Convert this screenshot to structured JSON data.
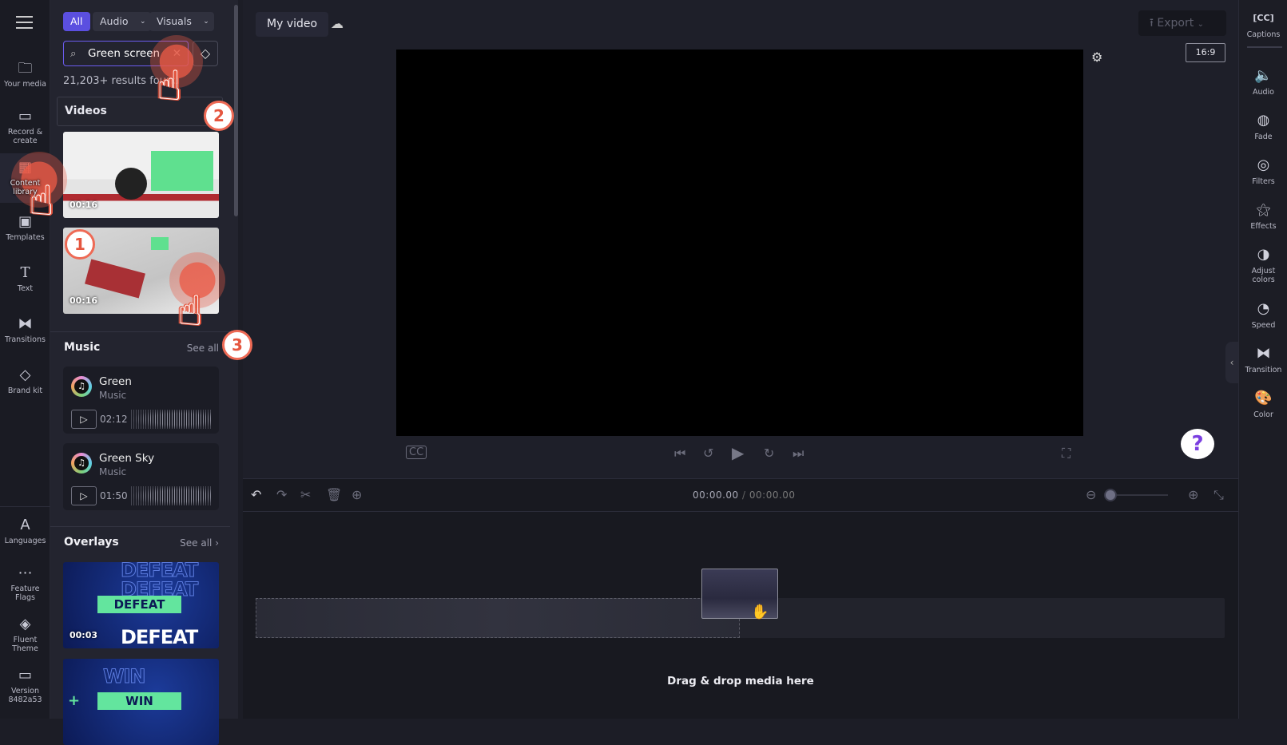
{
  "left_nav": {
    "items": [
      {
        "label": "Your media",
        "icon": "folder-icon"
      },
      {
        "label": "Record & create",
        "icon": "camera-icon"
      },
      {
        "label": "Content library",
        "icon": "content-library-icon",
        "active": true
      },
      {
        "label": "Templates",
        "icon": "templates-icon"
      },
      {
        "label": "Text",
        "icon": "text-icon"
      },
      {
        "label": "Transitions",
        "icon": "transitions-icon"
      },
      {
        "label": "Brand kit",
        "icon": "brand-kit-icon"
      },
      {
        "label": "Languages",
        "icon": "languages-icon"
      },
      {
        "label": "Feature Flags",
        "icon": "more-icon"
      },
      {
        "label": "Fluent Theme",
        "icon": "paint-bucket-icon"
      },
      {
        "label": "Version 8482a53",
        "icon": "archive-icon"
      }
    ]
  },
  "panel": {
    "filters": {
      "all": "All",
      "audio": "Audio",
      "visuals": "Visuals"
    },
    "search": {
      "value": "Green screen"
    },
    "results": "21,203+ results found",
    "videos": {
      "title": "Videos",
      "items": [
        {
          "duration": "00:16"
        },
        {
          "duration": "00:16"
        }
      ]
    },
    "music": {
      "title": "Music",
      "see_all": "See all",
      "items": [
        {
          "name": "Green",
          "type": "Music",
          "duration": "02:12"
        },
        {
          "name": "Green Sky",
          "type": "Music",
          "duration": "01:50"
        }
      ]
    },
    "overlays": {
      "title": "Overlays",
      "see_all": "See all",
      "items": [
        {
          "text": "DEFEAT",
          "duration": "00:03"
        },
        {
          "text": "WIN"
        }
      ]
    }
  },
  "header": {
    "title": "My video",
    "export": "Export",
    "aspect": "16:9"
  },
  "timeline": {
    "time_current": "00:00.00",
    "time_sep": "/",
    "time_total": "00:00.00",
    "zoom_level": 0,
    "drop_hint": "Drag & drop media here"
  },
  "right_bar": {
    "items": [
      {
        "label": "Captions",
        "icon": "captions-icon"
      },
      {
        "label": "Audio",
        "icon": "speaker-icon"
      },
      {
        "label": "Fade",
        "icon": "fade-icon"
      },
      {
        "label": "Filters",
        "icon": "filters-icon"
      },
      {
        "label": "Effects",
        "icon": "magic-wand-icon"
      },
      {
        "label": "Adjust colors",
        "icon": "contrast-icon"
      },
      {
        "label": "Speed",
        "icon": "speedometer-icon"
      },
      {
        "label": "Transition",
        "icon": "transition-icon"
      },
      {
        "label": "Color",
        "icon": "palette-icon"
      }
    ]
  },
  "annotations": {
    "steps": [
      "1",
      "2",
      "3"
    ],
    "accent": "#e5563f"
  },
  "colors": {
    "accent": "#5b4fe0",
    "background": "#1e1f29"
  }
}
